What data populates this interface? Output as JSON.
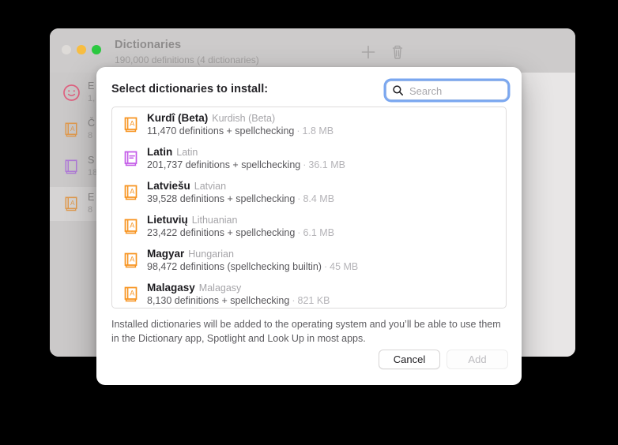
{
  "background_window": {
    "title": "Dictionaries",
    "subtitle": "190,000 definitions (4 dictionaries)",
    "traffic_lights": {
      "close": "close-button",
      "minimize": "minimize-button",
      "maximize": "maximize-button"
    },
    "toolbar": {
      "add_icon": "plus-icon",
      "delete_icon": "trash-icon"
    },
    "sidebar_items": [
      {
        "icon": "emoji-face-icon",
        "icon_color": "#e0607f",
        "label": "E",
        "sub": "1,"
      },
      {
        "icon": "book-a-icon",
        "icon_color": "#e09a4e",
        "label": "Č",
        "sub": "8"
      },
      {
        "icon": "book-plain-icon",
        "icon_color": "#b07ad8",
        "label": "S",
        "sub": "18"
      },
      {
        "icon": "book-a-icon",
        "icon_color": "#e09a4e",
        "label": "E",
        "sub": "8"
      }
    ]
  },
  "dialog": {
    "heading": "Select dictionaries to install:",
    "search": {
      "icon": "search-icon",
      "placeholder": "Search",
      "value": ""
    },
    "dictionaries": [
      {
        "native_name": "Kurdî (Beta)",
        "english_name": "Kurdish (Beta)",
        "definitions": "11,470 definitions + spellchecking",
        "separator": "·",
        "size": "1.8 MB",
        "icon": "book-a-icon",
        "icon_color": "#f79420"
      },
      {
        "native_name": "Latin",
        "english_name": "Latin",
        "definitions": "201,737 definitions + spellchecking",
        "separator": "·",
        "size": "36.1 MB",
        "icon": "book-lines-icon",
        "icon_color": "#c35ae8"
      },
      {
        "native_name": "Latviešu",
        "english_name": "Latvian",
        "definitions": "39,528 definitions + spellchecking",
        "separator": "·",
        "size": "8.4 MB",
        "icon": "book-a-icon",
        "icon_color": "#f79420"
      },
      {
        "native_name": "Lietuvių",
        "english_name": "Lithuanian",
        "definitions": "23,422 definitions + spellchecking",
        "separator": "·",
        "size": "6.1 MB",
        "icon": "book-a-icon",
        "icon_color": "#f79420"
      },
      {
        "native_name": "Magyar",
        "english_name": "Hungarian",
        "definitions": "98,472 definitions (spellchecking builtin)",
        "separator": "·",
        "size": "45 MB",
        "icon": "book-a-icon",
        "icon_color": "#f79420"
      },
      {
        "native_name": "Malagasy",
        "english_name": "Malagasy",
        "definitions": "8,130 definitions + spellchecking",
        "separator": "·",
        "size": "821 KB",
        "icon": "book-a-icon",
        "icon_color": "#f79420"
      }
    ],
    "footer_note": "Installed dictionaries will be added to the operating system and you’ll be able to use them in the Dictionary app, Spotlight and Look Up in most apps.",
    "buttons": {
      "cancel": "Cancel",
      "add": "Add"
    }
  },
  "colors": {
    "focus_ring": "#7aa7f0",
    "orange_icon": "#f79420",
    "purple_icon": "#c35ae8",
    "window_gray": "#cfcdcd"
  }
}
